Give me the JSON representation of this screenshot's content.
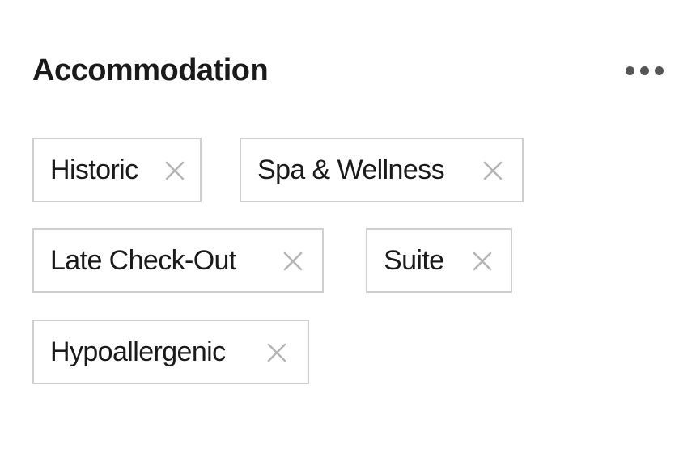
{
  "panel": {
    "title": "Accommodation",
    "more_icon": "more-horizontal-icon"
  },
  "tags": [
    {
      "label": "Historic",
      "remove_icon": "close-icon"
    },
    {
      "label": "Spa & Wellness",
      "remove_icon": "close-icon"
    },
    {
      "label": "Late Check-Out",
      "remove_icon": "close-icon"
    },
    {
      "label": "Suite",
      "remove_icon": "close-icon"
    },
    {
      "label": "Hypoallergenic",
      "remove_icon": "close-icon"
    }
  ],
  "colors": {
    "text": "#1a1a1a",
    "chip_border": "#cfcfcf",
    "remove_icon": "#b5b5b5",
    "more_dots": "#555555"
  }
}
